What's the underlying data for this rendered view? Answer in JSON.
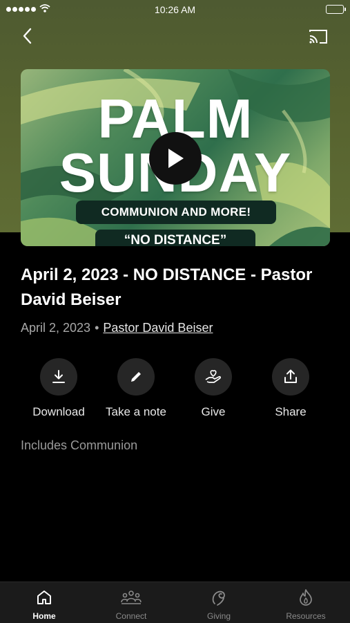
{
  "status_bar": {
    "time": "10:26 AM"
  },
  "video": {
    "title_line1": "PALM",
    "title_line2": "SUNDAY",
    "subtitle": "COMMUNION AND MORE!",
    "subtitle2": "“NO DISTANCE”"
  },
  "sermon": {
    "title": "April 2, 2023 - NO DISTANCE - Pastor David Beiser",
    "date": "April 2, 2023",
    "separator": "•",
    "speaker": "Pastor David Beiser",
    "note": "Includes Communion"
  },
  "actions": [
    {
      "label": "Download",
      "icon": "download-icon"
    },
    {
      "label": "Take a note",
      "icon": "pencil-icon"
    },
    {
      "label": "Give",
      "icon": "give-hand-heart-icon"
    },
    {
      "label": "Share",
      "icon": "share-icon"
    }
  ],
  "tabs": [
    {
      "label": "Home",
      "icon": "home-icon",
      "active": true
    },
    {
      "label": "Connect",
      "icon": "people-group-icon",
      "active": false
    },
    {
      "label": "Giving",
      "icon": "giving-icon",
      "active": false
    },
    {
      "label": "Resources",
      "icon": "flame-icon",
      "active": false
    }
  ],
  "colors": {
    "header_bg": "#56622f",
    "background": "#000000",
    "tab_bar_bg": "#1b1b1b",
    "action_circle": "#262626"
  }
}
